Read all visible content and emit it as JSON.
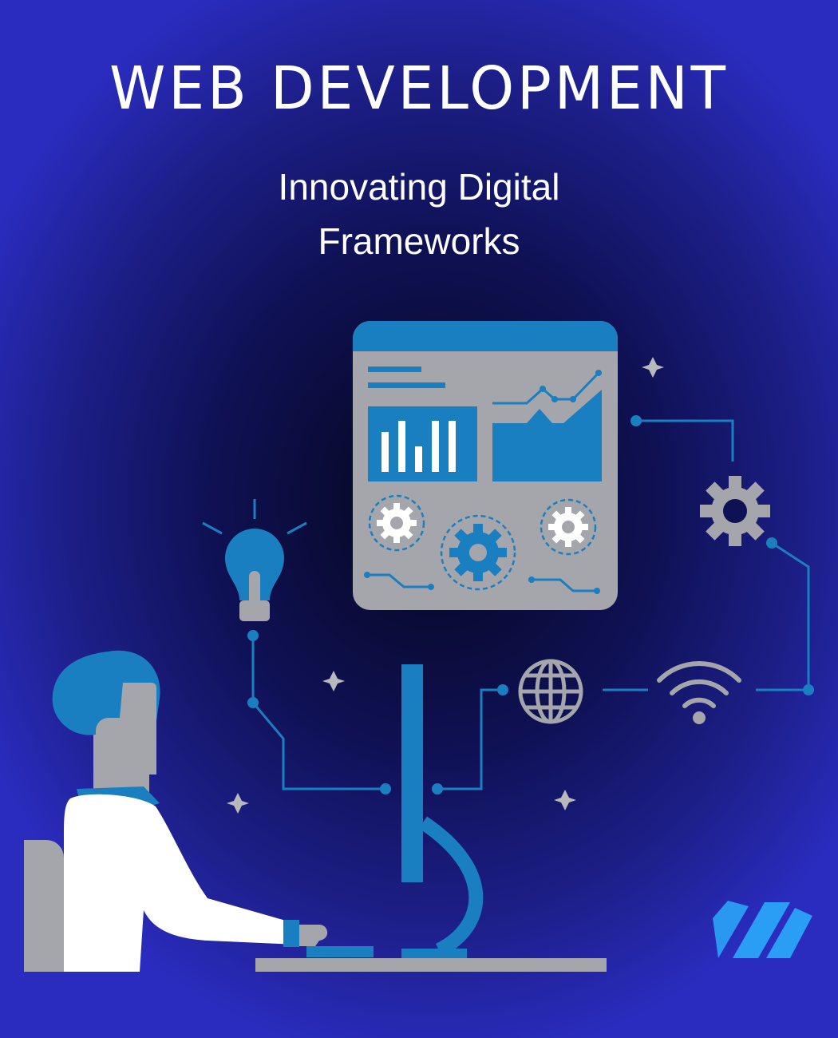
{
  "header": {
    "title": "WEB DEVELOPMENT",
    "subtitle_line1": "Innovating Digital",
    "subtitle_line2": "Frameworks"
  },
  "colors": {
    "accent_blue": "#1a7fc0",
    "panel_gray": "#a4a6ab",
    "white": "#ffffff",
    "logo_blue": "#2a9df4"
  },
  "icons": [
    "lightbulb-icon",
    "gear-icon",
    "globe-icon",
    "wifi-icon",
    "sparkle-icon",
    "brand-logo"
  ]
}
